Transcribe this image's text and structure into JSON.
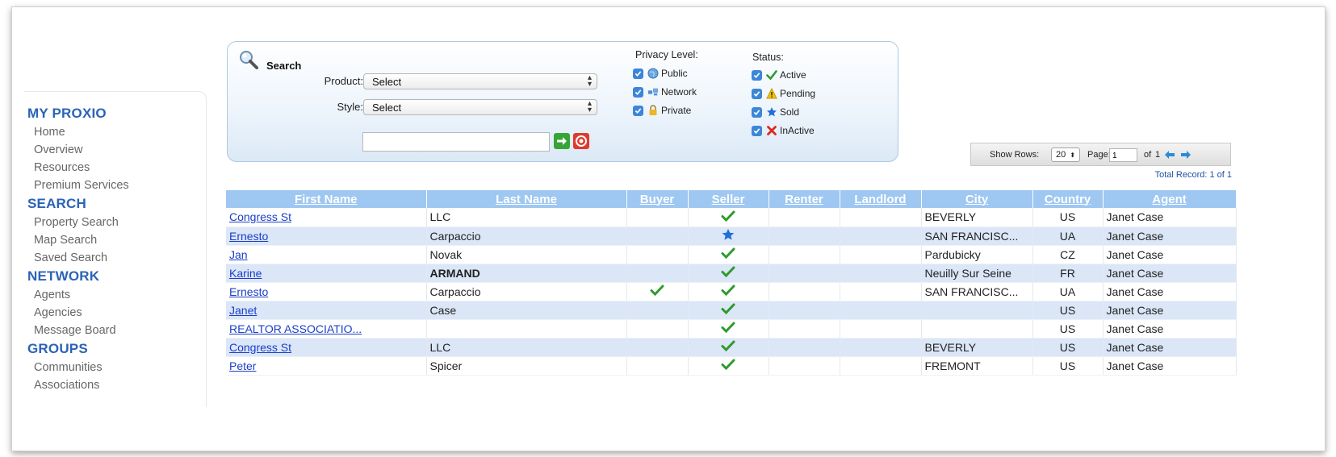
{
  "sidebar": {
    "groups": [
      {
        "heading": "MY PROXIO",
        "items": [
          "Home",
          "Overview",
          "Resources",
          "Premium Services"
        ]
      },
      {
        "heading": "SEARCH",
        "items": [
          "Property Search",
          "Map Search",
          "Saved Search"
        ]
      },
      {
        "heading": "NETWORK",
        "items": [
          "Agents",
          "Agencies",
          "Message Board"
        ]
      },
      {
        "heading": "GROUPS",
        "items": [
          "Communities",
          "Associations"
        ]
      }
    ]
  },
  "search": {
    "title": "Search",
    "product_label": "Product:",
    "product_value": "Select",
    "style_label": "Style:",
    "style_value": "Select",
    "text_value": "",
    "privacy_title": "Privacy Level:",
    "privacy": [
      {
        "label": "Public",
        "icon": "globe-icon"
      },
      {
        "label": "Network",
        "icon": "network-icon"
      },
      {
        "label": "Private",
        "icon": "lock-icon"
      }
    ],
    "status_title": "Status:",
    "status": [
      {
        "label": "Active",
        "icon": "check-icon"
      },
      {
        "label": "Pending",
        "icon": "warning-icon"
      },
      {
        "label": "Sold",
        "icon": "star-icon"
      },
      {
        "label": "InActive",
        "icon": "x-icon"
      }
    ]
  },
  "pager": {
    "show_rows_label": "Show Rows:",
    "rows_value": "20",
    "page_label": "Page:",
    "page_value": "1",
    "of_label": "of",
    "page_total": "1",
    "total_record": "Total Record: 1 of 1"
  },
  "table": {
    "headers": [
      "First Name",
      "Last Name",
      "Buyer",
      "Seller",
      "Renter",
      "Landlord",
      "City",
      "Country",
      "Agent"
    ],
    "rows": [
      {
        "first": "Congress St",
        "last": "LLC",
        "last_bold": false,
        "buyer": "",
        "seller": "check",
        "city": "BEVERLY",
        "country": "US",
        "agent": "Janet Case"
      },
      {
        "first": "Ernesto",
        "last": "Carpaccio",
        "last_bold": false,
        "buyer": "",
        "seller": "star",
        "city": "SAN FRANCISC...",
        "country": "UA",
        "agent": "Janet Case"
      },
      {
        "first": "Jan",
        "last": "Novak",
        "last_bold": false,
        "buyer": "",
        "seller": "check",
        "city": "Pardubicky",
        "country": "CZ",
        "agent": "Janet Case"
      },
      {
        "first": "Karine",
        "last": "ARMAND",
        "last_bold": true,
        "buyer": "",
        "seller": "check",
        "city": "Neuilly Sur Seine",
        "country": "FR",
        "agent": "Janet Case"
      },
      {
        "first": "Ernesto",
        "last": "Carpaccio",
        "last_bold": false,
        "buyer": "check",
        "seller": "check",
        "city": "SAN FRANCISC...",
        "country": "UA",
        "agent": "Janet Case"
      },
      {
        "first": "Janet",
        "last": "Case",
        "last_bold": false,
        "buyer": "",
        "seller": "check",
        "city": "",
        "country": "US",
        "agent": "Janet Case"
      },
      {
        "first": "REALTOR ASSOCIATIO...",
        "last": "",
        "last_bold": false,
        "buyer": "",
        "seller": "check",
        "city": "",
        "country": "US",
        "agent": "Janet Case"
      },
      {
        "first": "Congress St",
        "last": "LLC",
        "last_bold": false,
        "buyer": "",
        "seller": "check",
        "city": "BEVERLY",
        "country": "US",
        "agent": "Janet Case"
      },
      {
        "first": "Peter",
        "last": "Spicer",
        "last_bold": false,
        "buyer": "",
        "seller": "check",
        "city": "FREMONT",
        "country": "US",
        "agent": "Janet Case"
      }
    ]
  },
  "colors": {
    "accent": "#2b63b6",
    "header_bg": "#9ec7f1",
    "row_alt": "#dbe6f7",
    "check_green": "#2e9a2e",
    "star_blue": "#1f6fd6"
  }
}
